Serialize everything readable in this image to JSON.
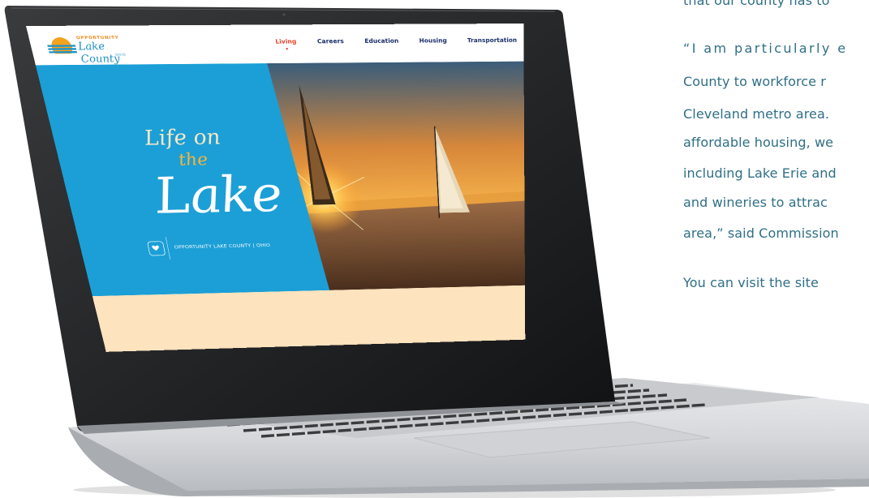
{
  "article": {
    "lines": [
      "that our county has to",
      "“I am particularly e",
      "County to workforce r",
      "Cleveland metro area.",
      "affordable housing, we",
      "including Lake Erie and",
      "and wineries to attrac",
      "area,” said Commission",
      "You can visit the site"
    ],
    "wave_icon": "wave-icon",
    "color": "#2f6f86"
  },
  "site": {
    "logo": {
      "tagline": "OPPORTUNITY",
      "name": "Lake County",
      "state": "OHIO",
      "icon": "sun-logo-icon"
    },
    "nav": [
      "Living",
      "Careers",
      "Education",
      "Housing",
      "Transportation"
    ],
    "active_nav": "Living",
    "hero": {
      "script_line1": "Life on",
      "script_line2": "the",
      "script_line3": "Lake",
      "badge_icon": "ohio-heart-icon",
      "badge_text": "OPPORTUNITY LAKE COUNTY | OHIO"
    },
    "colors": {
      "panel_blue": "#1b9fd6",
      "nav_active": "#e8412a",
      "nav_text": "#1b2f6b",
      "band_peach": "#fde3be"
    }
  }
}
